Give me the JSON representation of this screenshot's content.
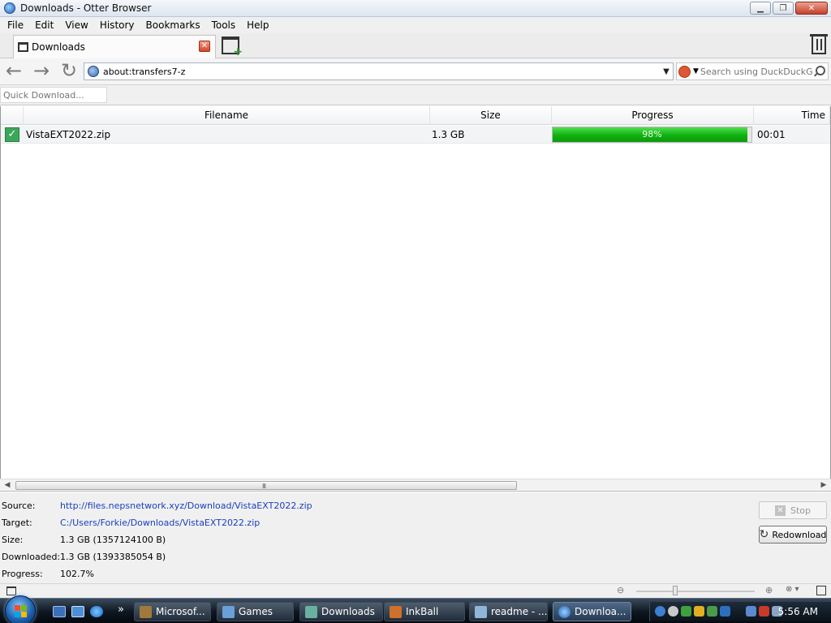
{
  "window": {
    "title": "Downloads - Otter Browser",
    "minimize": "▁",
    "maximize": "❐",
    "close": "✕"
  },
  "menu": [
    "File",
    "Edit",
    "View",
    "History",
    "Bookmarks",
    "Tools",
    "Help"
  ],
  "tab": {
    "label": "Downloads",
    "close": "✕"
  },
  "new_tab_plus": "+",
  "nav": {
    "back": "←",
    "forward": "→",
    "reload": "↻"
  },
  "address": {
    "value": "about:transfers7-z",
    "dropdown": "▼"
  },
  "search": {
    "placeholder": "Search using DuckDuckGo",
    "engine_dropdown": "▼"
  },
  "quick_download": {
    "placeholder": "Quick Download..."
  },
  "table": {
    "columns": [
      "Filename",
      "Size",
      "Progress",
      "Time"
    ],
    "rows": [
      {
        "status": "completed",
        "check": "✓",
        "filename": "VistaEXT2022.zip",
        "size": "1.3 GB",
        "progress_text": "98%",
        "progress": 0.98,
        "time": "00:01"
      }
    ]
  },
  "scrollbar": {
    "left": "◀",
    "right": "▶",
    "grip": "III"
  },
  "details": {
    "source_label": "Source:",
    "source_value": "http://files.nepsnetwork.xyz/Download/VistaEXT2022.zip",
    "target_label": "Target:",
    "target_value": "C:/Users/Forkie/Downloads/VistaEXT2022.zip",
    "size_label": "Size:",
    "size_value": "1.3 GB (1357124100 B)",
    "downloaded_label": "Downloaded:",
    "downloaded_value": "1.3 GB (1393385054 B)",
    "progress_label": "Progress:",
    "progress_value": "102.7%",
    "stop_button": "Stop",
    "stop_icon": "✕",
    "redownload_button": "Redownload",
    "redownload_icon": "↻"
  },
  "statusbar": {
    "zoom_out": "⊖",
    "zoom_in": "⊕",
    "misc": "⊗ ▾"
  },
  "taskbar": {
    "quicklaunch_more": "»",
    "buttons": [
      "Microsof...",
      "Games",
      "Downloads",
      "InkBall",
      "readme - ...",
      "Downloa..."
    ],
    "clock": "5:56 AM"
  },
  "colors": {
    "progress_green": "#10b010",
    "link_blue": "#1a3fbf",
    "accent_close": "#c4412b"
  }
}
